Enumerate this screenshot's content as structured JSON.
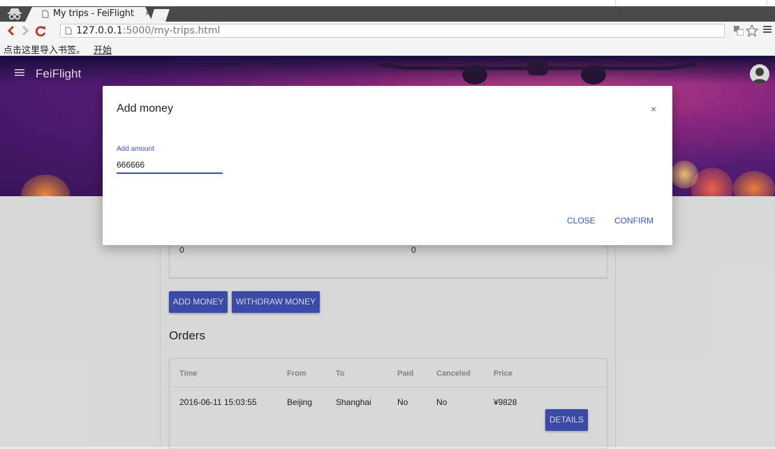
{
  "browser": {
    "tab_title": "My trips - FeiFlight",
    "tab_close": "×",
    "url_host": "127.0.0.1",
    "url_rest": ":5000/my-trips.html",
    "bookmarks_prompt": "点击这里导入书签。",
    "bookmarks_start": "开始"
  },
  "app": {
    "brand": "FeiFlight"
  },
  "balance": {
    "left_value": "0",
    "right_value": "0"
  },
  "actions": {
    "add_money": "ADD MONEY",
    "withdraw_money": "WITHDRAW MONEY"
  },
  "orders": {
    "title": "Orders",
    "headers": [
      "Time",
      "From",
      "To",
      "Paid",
      "Canceled",
      "Price"
    ],
    "rows": [
      {
        "time": "2016-06-11 15:03:55",
        "from": "Beijing",
        "to": "Shanghai",
        "paid": "No",
        "canceled": "No",
        "price": "¥9828",
        "action": "DETAILS"
      }
    ]
  },
  "modal": {
    "title": "Add money",
    "close_icon": "×",
    "field_label": "Add amount",
    "field_value": "666666",
    "close_label": "CLOSE",
    "confirm_label": "CONFIRM"
  },
  "colors": {
    "primary": "#3f51b5"
  }
}
